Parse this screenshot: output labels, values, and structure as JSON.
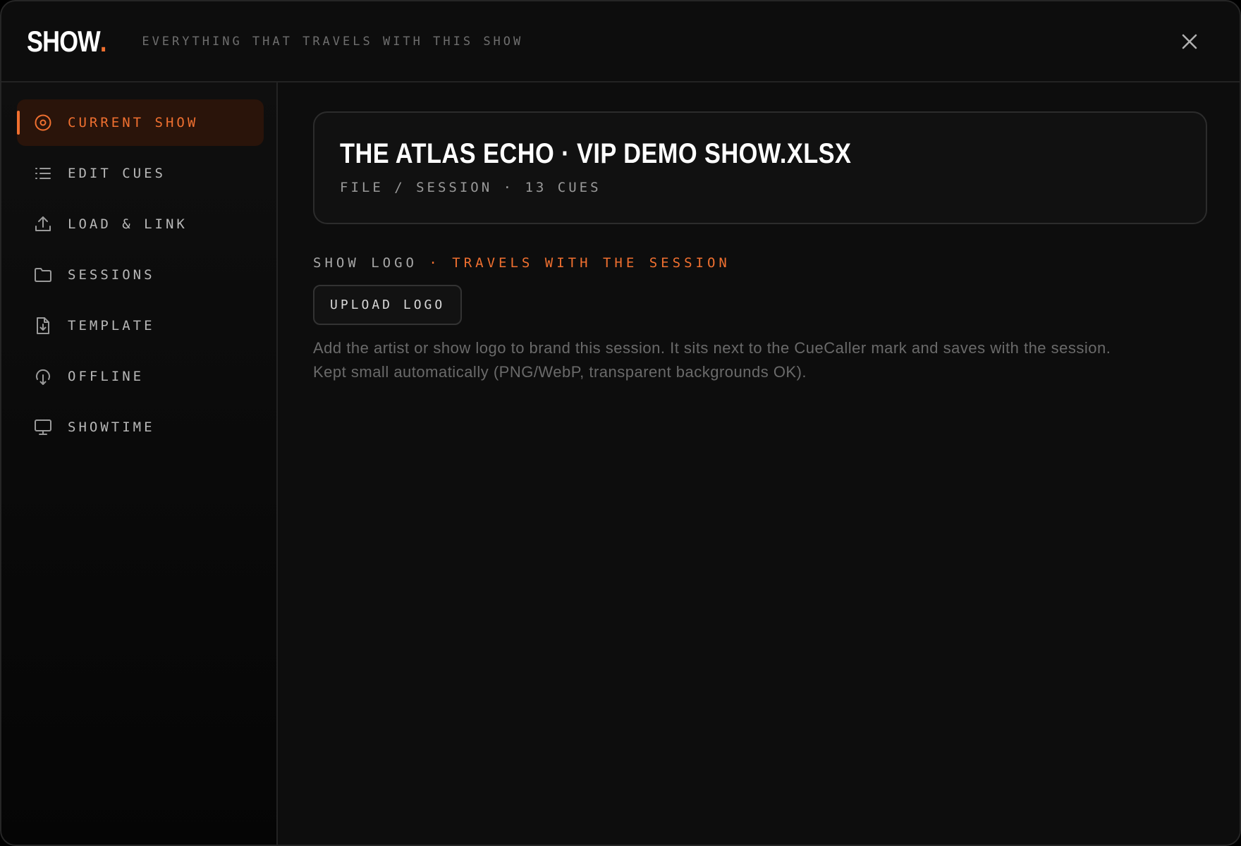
{
  "header": {
    "brand": "SHOW",
    "brand_dot": ".",
    "tagline": "EVERYTHING THAT TRAVELS WITH THIS SHOW",
    "close_icon": "close-icon"
  },
  "sidebar": {
    "items": [
      {
        "label": "CURRENT SHOW",
        "icon": "target-icon",
        "active": true
      },
      {
        "label": "EDIT CUES",
        "icon": "list-icon",
        "active": false
      },
      {
        "label": "LOAD & LINK",
        "icon": "upload-icon",
        "active": false
      },
      {
        "label": "SESSIONS",
        "icon": "folder-icon",
        "active": false
      },
      {
        "label": "TEMPLATE",
        "icon": "file-download-icon",
        "active": false
      },
      {
        "label": "OFFLINE",
        "icon": "cloud-download-icon",
        "active": false
      },
      {
        "label": "SHOWTIME",
        "icon": "monitor-icon",
        "active": false
      }
    ]
  },
  "main": {
    "file_title": "THE ATLAS ECHO · VIP DEMO SHOW.XLSX",
    "file_meta": "FILE / SESSION · 13 CUES",
    "logo_section": {
      "label": "SHOW LOGO",
      "accent": "· TRAVELS WITH THE SESSION",
      "upload_button": "UPLOAD LOGO",
      "help_line1": "Add the artist or show logo to brand this session. It sits next to the CueCaller mark and saves with the session.",
      "help_line2": "Kept small automatically (PNG/WebP, transparent backgrounds OK)."
    }
  },
  "colors": {
    "accent": "#f07030",
    "background": "#0d0d0d",
    "active_nav_bg": "#2a140a"
  }
}
